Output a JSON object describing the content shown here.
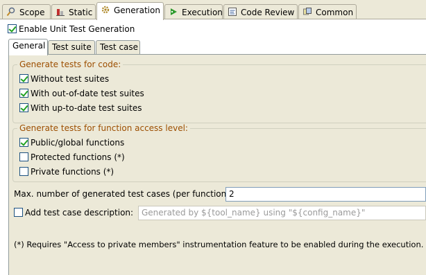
{
  "tabs": [
    {
      "label": "Scope",
      "icon": "scope-icon"
    },
    {
      "label": "Static",
      "icon": "static-icon"
    },
    {
      "label": "Generation",
      "icon": "gear-icon"
    },
    {
      "label": "Execution",
      "icon": "execution-icon"
    },
    {
      "label": "Code Review",
      "icon": "code-review-icon"
    },
    {
      "label": "Common",
      "icon": "common-icon"
    }
  ],
  "enable": {
    "label": "Enable Unit Test Generation",
    "checked": true
  },
  "subtabs": [
    {
      "label": "General"
    },
    {
      "label": "Test suite"
    },
    {
      "label": "Test case"
    }
  ],
  "group1": {
    "title": "Generate tests for code:",
    "items": [
      {
        "label": "Without test suites",
        "checked": true
      },
      {
        "label": "With out-of-date test suites",
        "checked": true
      },
      {
        "label": "With up-to-date test suites",
        "checked": true
      }
    ]
  },
  "group2": {
    "title": "Generate tests for function access level:",
    "items": [
      {
        "label": "Public/global functions",
        "checked": true
      },
      {
        "label": "Protected functions (*)",
        "checked": false
      },
      {
        "label": "Private functions (*)",
        "checked": false
      }
    ]
  },
  "max_cases": {
    "label": "Max. number of generated test cases (per function):",
    "value": "2"
  },
  "description": {
    "label": "Add test case description:",
    "checked": false,
    "value": "Generated by ${tool_name} using \"${config_name}\""
  },
  "footnote": "(*) Requires \"Access to private members\" instrumentation feature to be enabled during the execution.",
  "colors": {
    "group_title": "#9c4e00",
    "background": "#ece9d8",
    "check": "#21a121"
  }
}
